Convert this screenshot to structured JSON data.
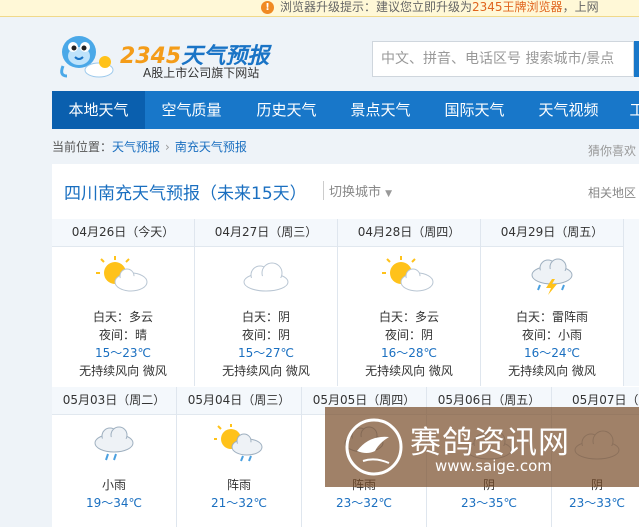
{
  "notice": {
    "prefix": "浏览器升级提示：建议您立即升级为",
    "brand": "2345王牌浏览器",
    "suffix": "，上网"
  },
  "logo": {
    "brand_digits": "2345",
    "brand_rest": "天气预报",
    "subtitle": "A股上市公司旗下网站"
  },
  "search": {
    "placeholder": "中文、拼音、电话区号  搜索城市/景点"
  },
  "nav": {
    "items": [
      "本地天气",
      "空气质量",
      "历史天气",
      "景点天气",
      "国际天气",
      "天气视频",
      "工"
    ]
  },
  "breadcrumb": {
    "prefix": "当前位置：",
    "home": "天气预报",
    "current": "南充天气预报"
  },
  "recommend": "猜你喜欢",
  "panel": {
    "title": "四川南充天气预报（未来15天）",
    "switch_label": "切换城市",
    "related": "相关地区"
  },
  "days_row1": [
    {
      "date": "04月26日（今天）",
      "icon": "sun-cloud-icon",
      "day": "白天：多云",
      "night": "夜间：晴",
      "temp": "15～23℃",
      "wind": "无持续风向 微风"
    },
    {
      "date": "04月27日（周三）",
      "icon": "cloud-icon",
      "day": "白天：阴",
      "night": "夜间：阴",
      "temp": "15～27℃",
      "wind": "无持续风向 微风"
    },
    {
      "date": "04月28日（周四）",
      "icon": "sun-cloud-icon",
      "day": "白天：多云",
      "night": "夜间：阴",
      "temp": "16～28℃",
      "wind": "无持续风向 微风"
    },
    {
      "date": "04月29日（周五）",
      "icon": "thunder-rain-icon",
      "day": "白天：雷阵雨",
      "night": "夜间：小雨",
      "temp": "16～24℃",
      "wind": "无持续风向 微风"
    }
  ],
  "days_row2": [
    {
      "date": "05月03日（周二）",
      "icon": "rain-icon",
      "cond": "小雨",
      "temp": "19～34℃"
    },
    {
      "date": "05月04日（周三）",
      "icon": "sun-rain-icon",
      "cond": "阵雨",
      "temp": "21～32℃"
    },
    {
      "date": "05月05日（周四）",
      "icon": "rain-icon",
      "cond": "阵雨",
      "temp": "23～32℃"
    },
    {
      "date": "05月06日（周五）",
      "icon": "cloud-icon",
      "cond": "阴",
      "temp": "23～35℃"
    },
    {
      "date": "05月07日（周",
      "icon": "cloud-icon",
      "cond": "阴",
      "temp": "23～33℃"
    }
  ],
  "watermark": {
    "text": "赛鸽资讯网",
    "url": "www.saige.com"
  },
  "colors": {
    "nav": "#1877c9",
    "nav_active": "#0a5fae",
    "link": "#1a6fc0",
    "accent": "#f49c19"
  }
}
